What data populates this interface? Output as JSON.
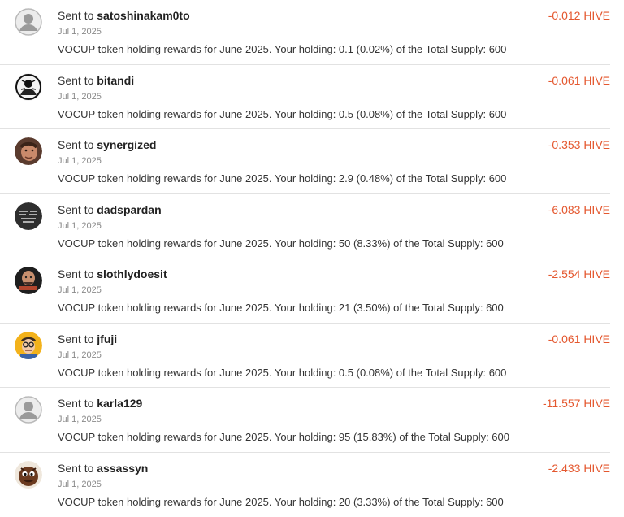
{
  "transfers": [
    {
      "prefix": "Sent to",
      "user": "satoshinakam0to",
      "date": "Jul 1, 2025",
      "memo": "VOCUP token holding rewards for June 2025. Your holding: 0.1 (0.02%) of the Total Supply: 600",
      "amount": "-0.012 HIVE",
      "avatar": "default-user-icon"
    },
    {
      "prefix": "Sent to",
      "user": "bitandi",
      "date": "Jul 1, 2025",
      "memo": "VOCUP token holding rewards for June 2025. Your holding: 0.5 (0.08%) of the Total Supply: 600",
      "amount": "-0.061 HIVE",
      "avatar": "bw-portrait-avatar"
    },
    {
      "prefix": "Sent to",
      "user": "synergized",
      "date": "Jul 1, 2025",
      "memo": "VOCUP token holding rewards for June 2025. Your holding: 2.9 (0.48%) of the Total Supply: 600",
      "amount": "-0.353 HIVE",
      "avatar": "face-photo-avatar"
    },
    {
      "prefix": "Sent to",
      "user": "dadspardan",
      "date": "Jul 1, 2025",
      "memo": "VOCUP token holding rewards for June 2025. Your holding: 50 (8.33%) of the Total Supply: 600",
      "amount": "-6.083 HIVE",
      "avatar": "dark-text-avatar"
    },
    {
      "prefix": "Sent to",
      "user": "slothlydoesit",
      "date": "Jul 1, 2025",
      "memo": "VOCUP token holding rewards for June 2025. Your holding: 21 (3.50%) of the Total Supply: 600",
      "amount": "-2.554 HIVE",
      "avatar": "bald-man-avatar"
    },
    {
      "prefix": "Sent to",
      "user": "jfuji",
      "date": "Jul 1, 2025",
      "memo": "VOCUP token holding rewards for June 2025. Your holding: 0.5 (0.08%) of the Total Supply: 600",
      "amount": "-0.061 HIVE",
      "avatar": "cartoon-glasses-avatar"
    },
    {
      "prefix": "Sent to",
      "user": "karla129",
      "date": "Jul 1, 2025",
      "memo": "VOCUP token holding rewards for June 2025. Your holding: 95 (15.83%) of the Total Supply: 600",
      "amount": "-11.557 HIVE",
      "avatar": "default-user-icon"
    },
    {
      "prefix": "Sent to",
      "user": "assassyn",
      "date": "Jul 1, 2025",
      "memo": "VOCUP token holding rewards for June 2025. Your holding: 20 (3.33%) of the Total Supply: 600",
      "amount": "-2.433 HIVE",
      "avatar": "brown-creature-avatar"
    }
  ],
  "colors": {
    "amount": "#e4572e",
    "divider": "#e2e2e2",
    "date": "#8a8a8a"
  }
}
